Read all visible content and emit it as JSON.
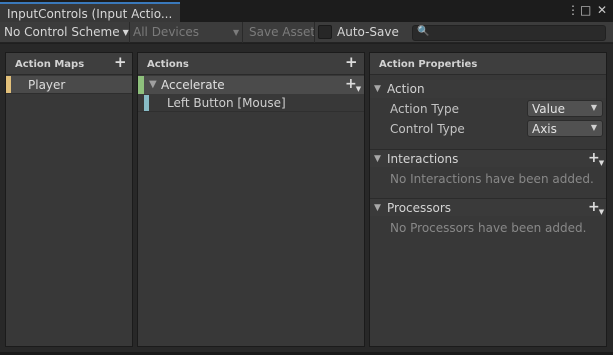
{
  "window": {
    "tab_title": "InputControls (Input Actio...",
    "menu_icon": "⋮",
    "restore_icon": "□",
    "close_icon": "✕"
  },
  "toolbar": {
    "control_scheme": "No Control Scheme",
    "devices": "All Devices",
    "save_asset": "Save Asset",
    "auto_save": "Auto-Save",
    "auto_save_checked": false,
    "search_value": "",
    "dropdown_arrow": "▼",
    "search_icon": "🔍"
  },
  "panels": {
    "action_maps": {
      "title": "Action Maps",
      "plus": "+",
      "items": [
        {
          "label": "Player",
          "selected": true
        }
      ]
    },
    "actions": {
      "title": "Actions",
      "plus": "+",
      "items": [
        {
          "label": "Accelerate",
          "expanded": true,
          "arrow": "▼",
          "bindings": [
            {
              "label": "Left Button [Mouse]"
            }
          ]
        }
      ]
    },
    "properties": {
      "title": "Action Properties",
      "action_section": {
        "label": "Action",
        "arrow": "▼",
        "action_type_label": "Action Type",
        "action_type_value": "Value",
        "control_type_label": "Control Type",
        "control_type_value": "Axis"
      },
      "interactions": {
        "label": "Interactions",
        "arrow": "▼",
        "empty": "No Interactions have been added."
      },
      "processors": {
        "label": "Processors",
        "arrow": "▼",
        "empty": "No Processors have been added."
      }
    }
  },
  "colors": {
    "map_marker": "#e2c07a",
    "action_marker": "#8ec07c",
    "binding_marker": "#88bcc6",
    "tab_accent": "#3a79bb"
  }
}
